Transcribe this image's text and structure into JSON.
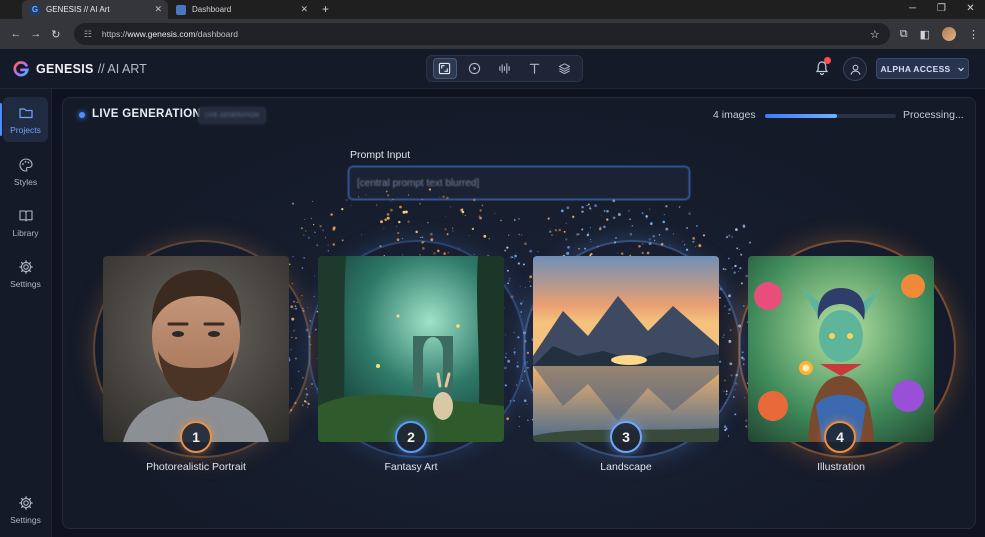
{
  "browser": {
    "tabs": [
      {
        "title": "GENESIS // AI Art",
        "active": true
      },
      {
        "title": "Dashboard",
        "active": false
      }
    ],
    "url_prefix": "https://",
    "url_host": "www.genesis.com",
    "url_path": "/dashboard"
  },
  "header": {
    "brand": "GENESIS",
    "brand_sub": "// AI ART",
    "mode_buttons": [
      "image-mode",
      "video-mode",
      "audio-mode",
      "text-mode",
      "layers-mode"
    ],
    "notification_count": 1,
    "access_label": "ALPHA ACCESS"
  },
  "sidebar": {
    "items": [
      {
        "label": "Projects",
        "icon": "folder-icon",
        "active": true
      },
      {
        "label": "Styles",
        "icon": "palette-icon",
        "active": false
      },
      {
        "label": "Library",
        "icon": "book-icon",
        "active": false
      },
      {
        "label": "Settings",
        "icon": "gear-icon",
        "active": false
      }
    ],
    "bottom_label": "Settings"
  },
  "generation": {
    "title": "LIVE GENERATION",
    "badge": "LIVE GENERATION",
    "image_count": "4 images",
    "progress": 0.55,
    "status": "Processing...",
    "prompt_label": "Prompt Input",
    "prompt_value": "[central prompt text blurred]"
  },
  "cards": [
    {
      "number": "1",
      "label": "Photorealistic Portrait",
      "accent": "#e8914a"
    },
    {
      "number": "2",
      "label": "Fantasy Art",
      "accent": "#5a9bff"
    },
    {
      "number": "3",
      "label": "Landscape",
      "accent": "#6fa8ff"
    },
    {
      "number": "4",
      "label": "Illustration",
      "accent": "#ef8c3f"
    }
  ],
  "colors": {
    "accent_blue": "#4c8dff",
    "panel": "#161c2b",
    "app_bg": "#0f1320"
  }
}
